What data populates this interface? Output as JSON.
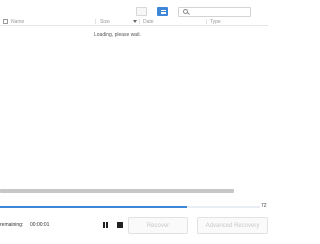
{
  "toolbar": {
    "view_list_icon": "list-view-icon",
    "view_grid_icon": "details-view-icon",
    "search_icon": "search-icon",
    "active_color": "#3d86d8"
  },
  "columns": [
    "Name",
    "Size",
    "Date",
    "Type"
  ],
  "list": {
    "loading_text": "Loading, please wait."
  },
  "progress": {
    "fraction": 0.72,
    "percent_label": "72"
  },
  "status": {
    "remaining_label": "remaining:",
    "remaining_time": "00:00:01"
  },
  "controls": {
    "pause_icon": "pause-icon",
    "stop_icon": "stop-icon"
  },
  "buttons": {
    "recover": "Recover",
    "advanced_recovery": "Advanced Recovery"
  }
}
